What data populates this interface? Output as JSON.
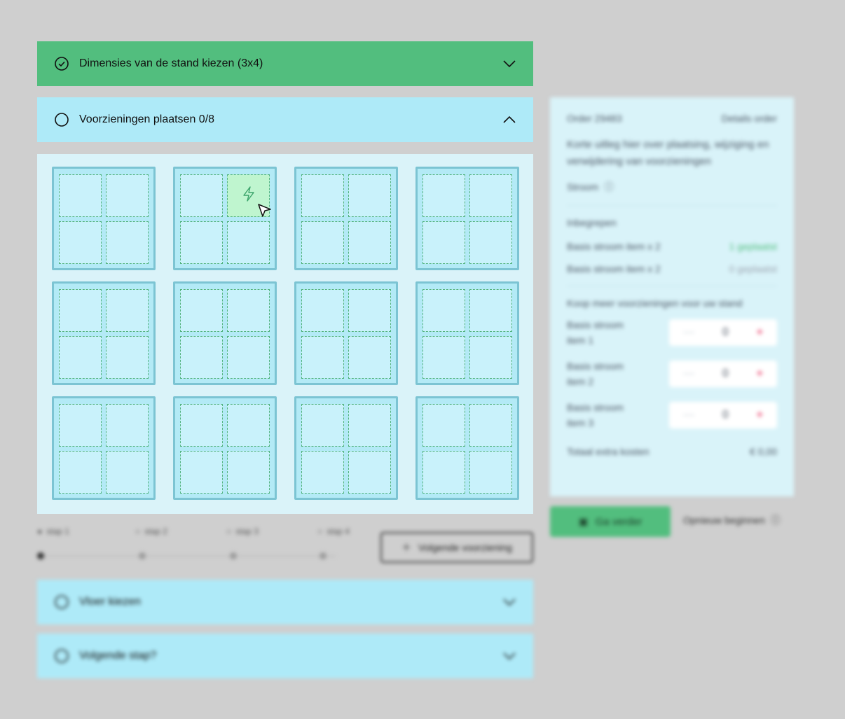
{
  "steps": [
    {
      "title": "Dimensies van de stand kiezen (3x4)",
      "state": "completed"
    },
    {
      "title": "Voorzieningen plaatsen 0/8",
      "state": "open"
    },
    {
      "title": "Vloer kiezen",
      "state": "collapsed"
    },
    {
      "title": "Volgende stap?",
      "state": "collapsed"
    }
  ],
  "stand_grid": {
    "rows": 3,
    "cols": 4,
    "cells_per_booth": 4,
    "active": {
      "booth": 2,
      "cell": 2,
      "icon": "lightning-icon"
    }
  },
  "progress": {
    "steps": [
      {
        "label": "stap 1"
      },
      {
        "label": "stap 2"
      },
      {
        "label": "stap 3"
      },
      {
        "label": "stap 4"
      }
    ],
    "next_button": "Volgende voorziening"
  },
  "sidebar": {
    "order_label": "Order 29483",
    "order_link": "Details order",
    "description": "Korte uitleg hier over plaatsing, wijziging en verwijdering van voorzieningen",
    "stroom_label": "Stroom",
    "section_included": "Inbegrepen",
    "included": [
      {
        "name": "Basis stroom item x 2",
        "status": "1 geplaatst",
        "color": "#52be7e"
      },
      {
        "name": "Basis stroom item x 2",
        "status": "0 geplaatst",
        "color": "#9ca3af"
      }
    ],
    "section_buy": "Koop meer voorzieningen voor uw stand",
    "buy_items": [
      {
        "name": "Basis stroom item 1",
        "qty": "0"
      },
      {
        "name": "Basis stroom item 2",
        "qty": "0"
      },
      {
        "name": "Basis stroom item 3",
        "qty": "0"
      }
    ],
    "total_label": "Totaal extra kosten",
    "total_value": "€ 0,00"
  },
  "go_button": "Ga verder",
  "help_link": "Opnieuw beginnen",
  "colors": {
    "complete": "#52be7e",
    "open": "#aeeaf8",
    "accent": "#ec4d74"
  }
}
